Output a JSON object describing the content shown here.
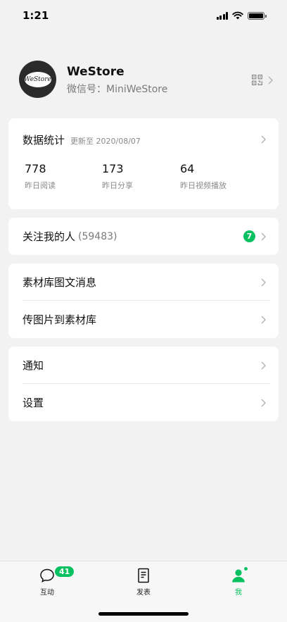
{
  "status_bar": {
    "time": "1:21"
  },
  "profile": {
    "avatar_text": "WeStore",
    "name": "WeStore",
    "wechat_id": "微信号：MiniWeStore"
  },
  "stats": {
    "title": "数据统计",
    "updated": "更新至 2020/08/07",
    "items": [
      {
        "value": "778",
        "label": "昨日阅读"
      },
      {
        "value": "173",
        "label": "昨日分享"
      },
      {
        "value": "64",
        "label": "昨日视频播放"
      }
    ]
  },
  "followers": {
    "label": "关注我的人",
    "count": "(59483)",
    "badge": "7"
  },
  "materials": {
    "items": [
      {
        "label": "素材库图文消息"
      },
      {
        "label": "传图片到素材库"
      }
    ]
  },
  "settings": {
    "items": [
      {
        "label": "通知"
      },
      {
        "label": "设置"
      }
    ]
  },
  "tabbar": {
    "tabs": [
      {
        "label": "互动",
        "badge": "41",
        "icon": "chat-bubble-icon"
      },
      {
        "label": "发表",
        "icon": "document-icon"
      },
      {
        "label": "我",
        "icon": "person-icon",
        "active": true
      }
    ]
  },
  "colors": {
    "accent": "#07c160",
    "background": "#f2f2f2"
  }
}
